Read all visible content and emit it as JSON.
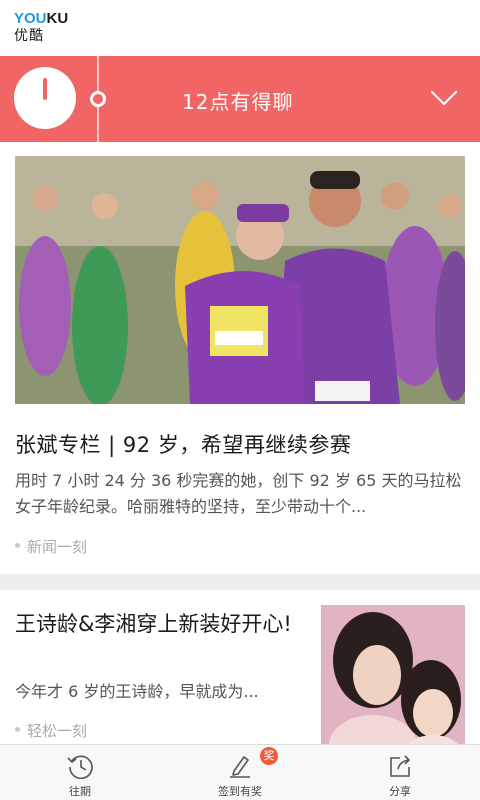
{
  "app": {
    "logo_text_blue": "YOU",
    "logo_text_dark": "KU",
    "logo_cn": "优酷"
  },
  "banner": {
    "title": "12点有得聊",
    "accent_color": "#f16565"
  },
  "feed": [
    {
      "title": "张斌专栏 | 92 岁，希望再继续参赛",
      "description": "用时 7 小时 24 分 36 秒完赛的她，创下 92 岁 65 天的马拉松女子年龄纪录。哈丽雅特的坚持，至少带动十个...",
      "source": "新闻一刻",
      "image": "marathon-runners-photo"
    },
    {
      "title": "王诗龄&李湘穿上新装好开心!",
      "description": "今年才 6 岁的王诗龄，早就成为...",
      "source": "轻松一刻",
      "image": "mother-daughter-photo"
    }
  ],
  "tabs": [
    {
      "label": "往期",
      "icon": "history-clock-icon"
    },
    {
      "label": "签到有奖",
      "icon": "pen-sign-icon",
      "badge": "奖"
    },
    {
      "label": "分享",
      "icon": "share-icon"
    }
  ]
}
